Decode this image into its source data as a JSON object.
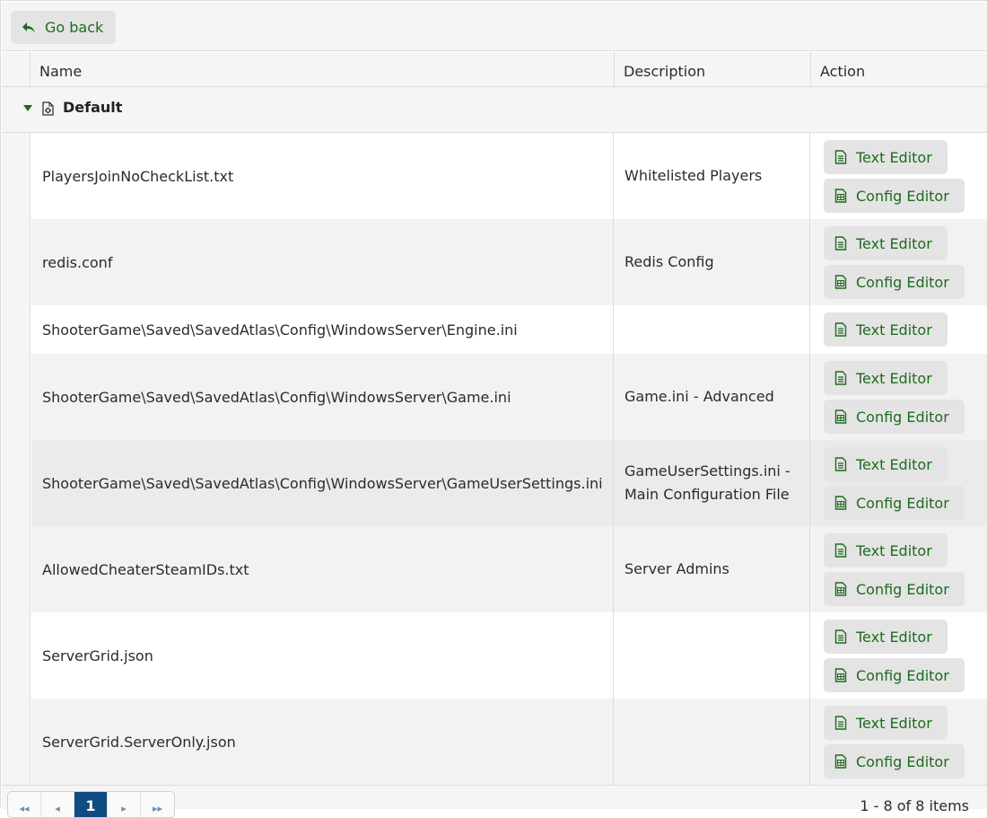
{
  "toolbar": {
    "go_back_label": "Go back"
  },
  "columns": {
    "name": "Name",
    "description": "Description",
    "action": "Action"
  },
  "group": {
    "title": "Default"
  },
  "buttons": {
    "text_editor": "Text Editor",
    "config_editor": "Config Editor"
  },
  "rows": [
    {
      "name": "PlayersJoinNoCheckList.txt",
      "description": "Whitelisted Players",
      "actions": [
        "Text Editor",
        "Config Editor"
      ]
    },
    {
      "name": "redis.conf",
      "description": "Redis Config",
      "actions": [
        "Text Editor",
        "Config Editor"
      ]
    },
    {
      "name": "ShooterGame\\Saved\\SavedAtlas\\Config\\WindowsServer\\Engine.ini",
      "description": "",
      "actions": [
        "Text Editor"
      ]
    },
    {
      "name": "ShooterGame\\Saved\\SavedAtlas\\Config\\WindowsServer\\Game.ini",
      "description": "Game.ini - Advanced",
      "actions": [
        "Text Editor",
        "Config Editor"
      ]
    },
    {
      "name": "ShooterGame\\Saved\\SavedAtlas\\Config\\WindowsServer\\GameUserSettings.ini",
      "description": "GameUserSettings.ini - Main Configuration File",
      "actions": [
        "Text Editor",
        "Config Editor"
      ]
    },
    {
      "name": "AllowedCheaterSteamIDs.txt",
      "description": "Server Admins",
      "actions": [
        "Text Editor",
        "Config Editor"
      ]
    },
    {
      "name": "ServerGrid.json",
      "description": "",
      "actions": [
        "Text Editor",
        "Config Editor"
      ]
    },
    {
      "name": "ServerGrid.ServerOnly.json",
      "description": "",
      "actions": [
        "Text Editor",
        "Config Editor"
      ]
    }
  ],
  "pager": {
    "current_page": "1",
    "info": "1 - 8 of 8 items"
  },
  "colors": {
    "accent_green": "#1e6b1e",
    "pager_active": "#0f4c81"
  }
}
